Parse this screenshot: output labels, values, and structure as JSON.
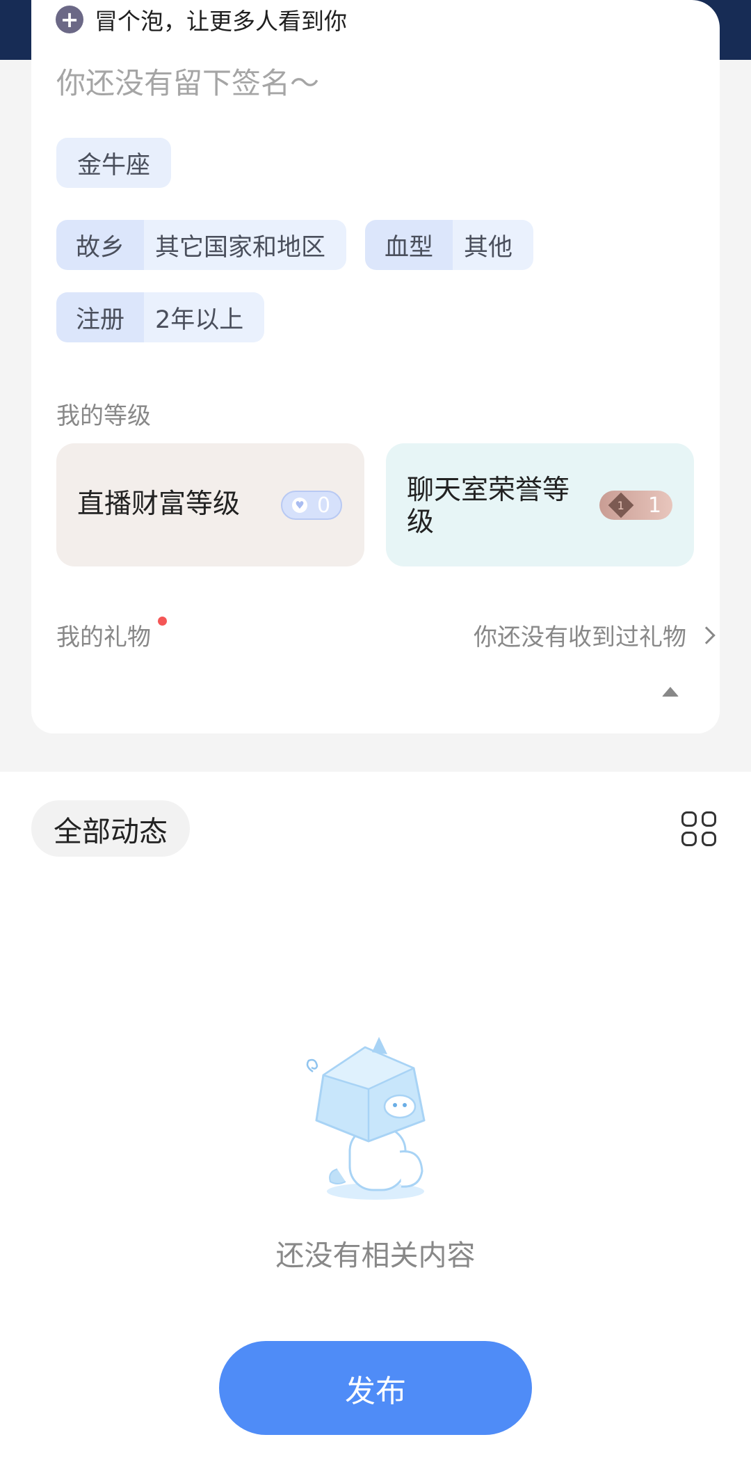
{
  "bubble": {
    "icon": "plus-icon",
    "text": "冒个泡，让更多人看到你"
  },
  "profile": {
    "signature_placeholder": "你还没有留下签名～",
    "zodiac": "金牛座",
    "hometown": {
      "label": "故乡",
      "value": "其它国家和地区"
    },
    "blood_type": {
      "label": "血型",
      "value": "其他"
    },
    "registered": {
      "label": "注册",
      "value": "2年以上"
    }
  },
  "levels": {
    "section_title": "我的等级",
    "wealth": {
      "title": "直播财富等级",
      "icon": "heart-icon",
      "value": "0"
    },
    "honor": {
      "title": "聊天室荣誉等级",
      "icon": "diamond-icon",
      "value": "1"
    }
  },
  "gifts": {
    "title": "我的礼物",
    "empty_text": "你还没有收到过礼物"
  },
  "feed": {
    "filter_label": "全部动态",
    "empty_text": "还没有相关内容",
    "publish_label": "发布"
  },
  "colors": {
    "header_bg": "#172c55",
    "accent_blue": "#4f8cf7",
    "tag_bg": "#e8effc",
    "wealth_card_bg": "#f3eeeb",
    "honor_card_bg": "#e7f5f6",
    "red_dot": "#f45656"
  }
}
